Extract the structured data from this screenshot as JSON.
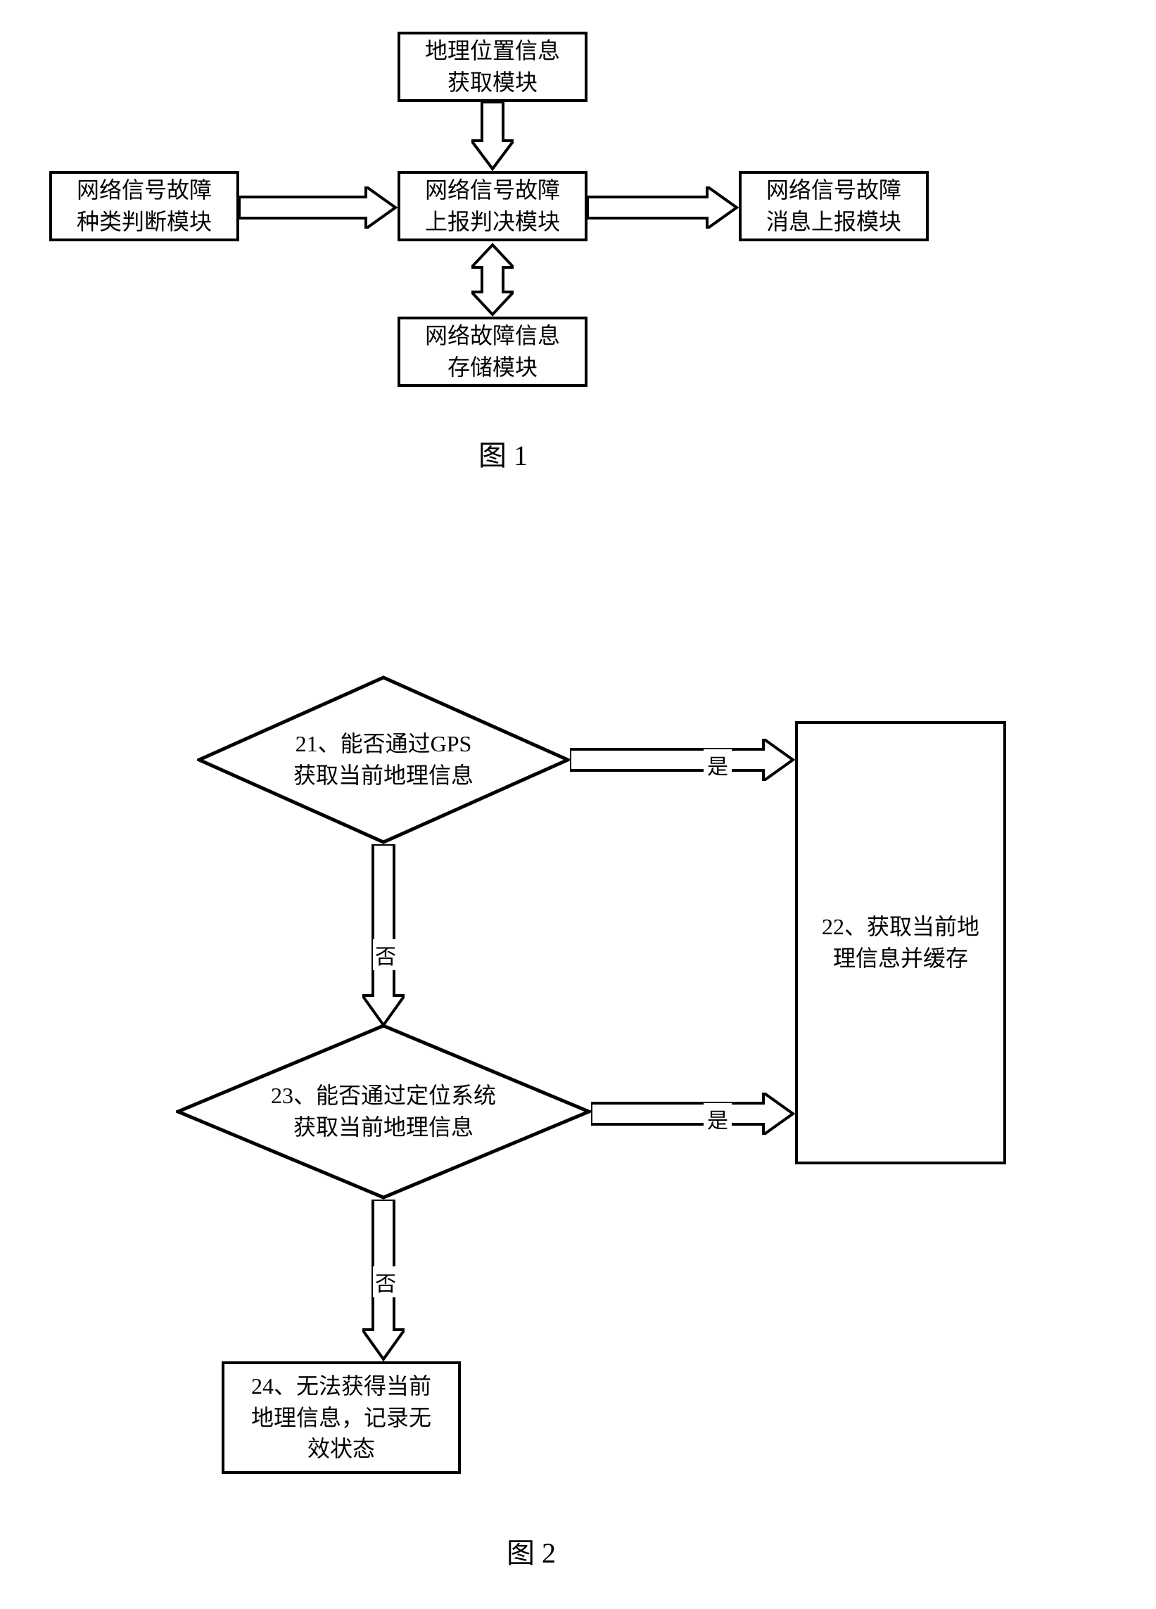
{
  "figure1": {
    "caption": "图 1",
    "boxes": {
      "geo_module": "地理位置信息\n获取模块",
      "fault_type_module": "网络信号故障\n种类判断模块",
      "report_decision_module": "网络信号故障\n上报判决模块",
      "msg_report_module": "网络信号故障\n消息上报模块",
      "fault_storage_module": "网络故障信息\n存储模块"
    }
  },
  "figure2": {
    "caption": "图 2",
    "nodes": {
      "step21": "21、能否通过GPS\n获取当前地理信息",
      "step22": "22、获取当前地\n理信息并缓存",
      "step23": "23、能否通过定位系统\n获取当前地理信息",
      "step24": "24、无法获得当前\n地理信息，记录无\n效状态"
    },
    "labels": {
      "yes": "是",
      "no": "否"
    }
  }
}
